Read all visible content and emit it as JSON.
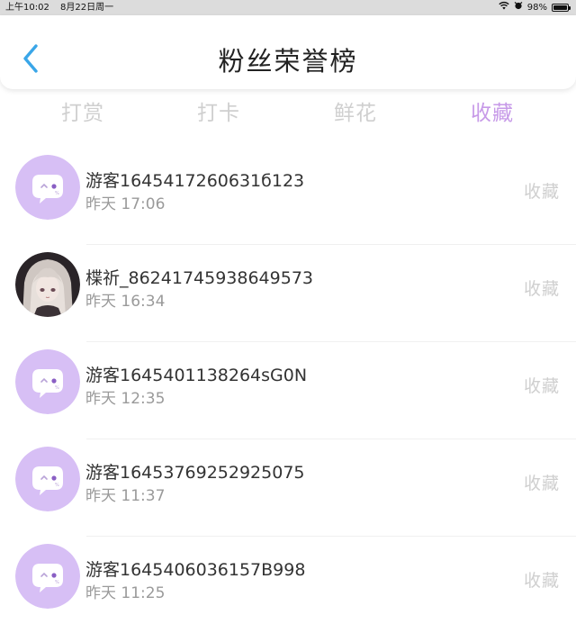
{
  "status_bar": {
    "time": "上午10:02",
    "date": "8月22日周一",
    "battery": "98%",
    "battery_level": 0.98
  },
  "header": {
    "title": "粉丝荣誉榜",
    "back_icon": "chevron-left-icon",
    "accent_color": "#3aa6e8"
  },
  "tabs": {
    "items": [
      {
        "label": "打赏"
      },
      {
        "label": "打卡"
      },
      {
        "label": "鲜花"
      },
      {
        "label": "收藏"
      }
    ],
    "active_index": 3,
    "active_color": "#c79ae8"
  },
  "list": {
    "items": [
      {
        "name": "游客1645417260631б123",
        "time": "昨天 17:06",
        "action": "收藏",
        "avatar": "default-chat-avatar"
      },
      {
        "name": "楪祈_86241745938649573",
        "time": "昨天 16:34",
        "action": "收藏",
        "avatar": "anime-girl-avatar"
      },
      {
        "name": "游客1645401138264sG0N",
        "time": "昨天 12:35",
        "action": "收藏",
        "avatar": "default-chat-avatar"
      },
      {
        "name": "游客16453769252925075",
        "time": "昨天 11:37",
        "action": "收藏",
        "avatar": "default-chat-avatar"
      },
      {
        "name": "游客1645406036157B998",
        "time": "昨天 11:25",
        "action": "收藏",
        "avatar": "default-chat-avatar"
      }
    ]
  }
}
